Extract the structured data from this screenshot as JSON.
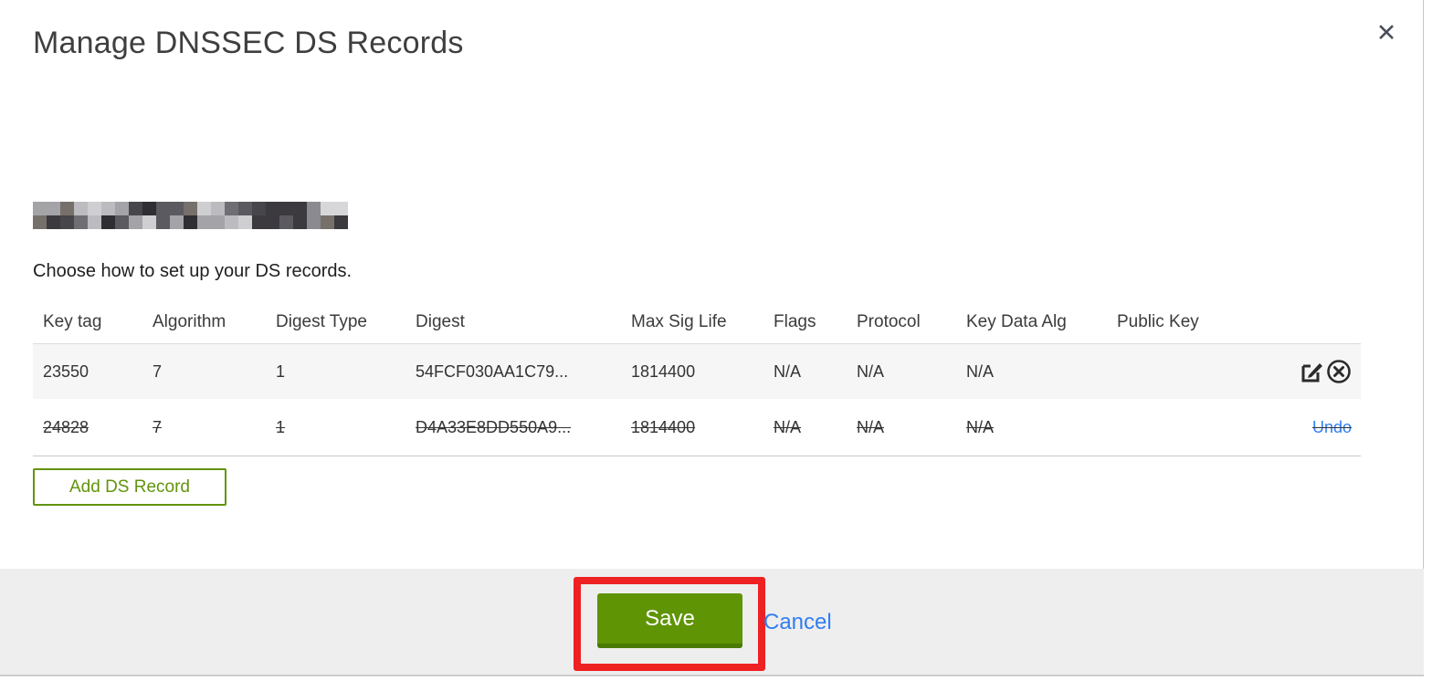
{
  "modal": {
    "title": "Manage DNSSEC DS Records",
    "close_icon_glyph": "✕",
    "subtitle": "Choose how to set up your DS records.",
    "domain_name_redacted": true
  },
  "table": {
    "columns": [
      "Key tag",
      "Algorithm",
      "Digest Type",
      "Digest",
      "Max Sig Life",
      "Flags",
      "Protocol",
      "Key Data Alg",
      "Public Key"
    ],
    "rows": [
      {
        "cells": [
          "23550",
          "7",
          "1",
          "54FCF030AA1C79...",
          "1814400",
          "N/A",
          "N/A",
          "N/A",
          ""
        ],
        "state": "normal",
        "actions": [
          "edit",
          "delete"
        ]
      },
      {
        "cells": [
          "24828",
          "7",
          "1",
          "D4A33E8DD550A9...",
          "1814400",
          "N/A",
          "N/A",
          "N/A",
          ""
        ],
        "state": "deleted",
        "undo_label": "Undo"
      }
    ]
  },
  "buttons": {
    "add_ds_record": "Add DS Record",
    "save": "Save",
    "cancel": "Cancel"
  },
  "colors": {
    "button_green": "#5f9404",
    "button_green_dark": "#4a7a02",
    "outline_green": "#61940b",
    "link_blue": "#317ef3",
    "annotation_red": "#ee2123",
    "footer_gray": "#eeeeee",
    "row_stripe_gray": "#f6f6f6"
  }
}
